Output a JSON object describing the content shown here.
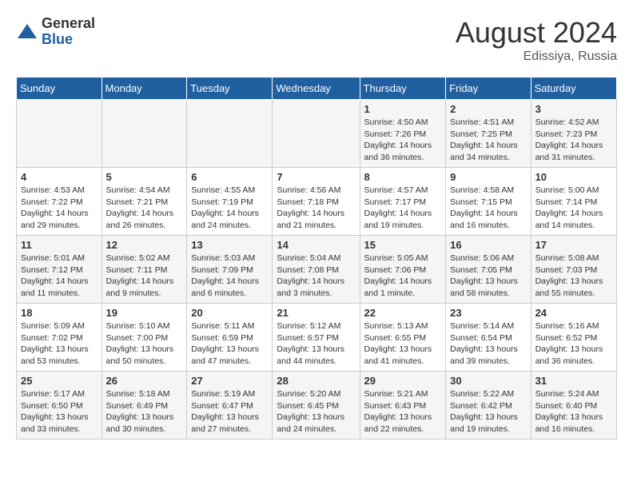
{
  "header": {
    "logo_general": "General",
    "logo_blue": "Blue",
    "month_title": "August 2024",
    "location": "Edissiya, Russia"
  },
  "weekdays": [
    "Sunday",
    "Monday",
    "Tuesday",
    "Wednesday",
    "Thursday",
    "Friday",
    "Saturday"
  ],
  "weeks": [
    [
      {
        "day": "",
        "info": ""
      },
      {
        "day": "",
        "info": ""
      },
      {
        "day": "",
        "info": ""
      },
      {
        "day": "",
        "info": ""
      },
      {
        "day": "1",
        "info": "Sunrise: 4:50 AM\nSunset: 7:26 PM\nDaylight: 14 hours\nand 36 minutes."
      },
      {
        "day": "2",
        "info": "Sunrise: 4:51 AM\nSunset: 7:25 PM\nDaylight: 14 hours\nand 34 minutes."
      },
      {
        "day": "3",
        "info": "Sunrise: 4:52 AM\nSunset: 7:23 PM\nDaylight: 14 hours\nand 31 minutes."
      }
    ],
    [
      {
        "day": "4",
        "info": "Sunrise: 4:53 AM\nSunset: 7:22 PM\nDaylight: 14 hours\nand 29 minutes."
      },
      {
        "day": "5",
        "info": "Sunrise: 4:54 AM\nSunset: 7:21 PM\nDaylight: 14 hours\nand 26 minutes."
      },
      {
        "day": "6",
        "info": "Sunrise: 4:55 AM\nSunset: 7:19 PM\nDaylight: 14 hours\nand 24 minutes."
      },
      {
        "day": "7",
        "info": "Sunrise: 4:56 AM\nSunset: 7:18 PM\nDaylight: 14 hours\nand 21 minutes."
      },
      {
        "day": "8",
        "info": "Sunrise: 4:57 AM\nSunset: 7:17 PM\nDaylight: 14 hours\nand 19 minutes."
      },
      {
        "day": "9",
        "info": "Sunrise: 4:58 AM\nSunset: 7:15 PM\nDaylight: 14 hours\nand 16 minutes."
      },
      {
        "day": "10",
        "info": "Sunrise: 5:00 AM\nSunset: 7:14 PM\nDaylight: 14 hours\nand 14 minutes."
      }
    ],
    [
      {
        "day": "11",
        "info": "Sunrise: 5:01 AM\nSunset: 7:12 PM\nDaylight: 14 hours\nand 11 minutes."
      },
      {
        "day": "12",
        "info": "Sunrise: 5:02 AM\nSunset: 7:11 PM\nDaylight: 14 hours\nand 9 minutes."
      },
      {
        "day": "13",
        "info": "Sunrise: 5:03 AM\nSunset: 7:09 PM\nDaylight: 14 hours\nand 6 minutes."
      },
      {
        "day": "14",
        "info": "Sunrise: 5:04 AM\nSunset: 7:08 PM\nDaylight: 14 hours\nand 3 minutes."
      },
      {
        "day": "15",
        "info": "Sunrise: 5:05 AM\nSunset: 7:06 PM\nDaylight: 14 hours\nand 1 minute."
      },
      {
        "day": "16",
        "info": "Sunrise: 5:06 AM\nSunset: 7:05 PM\nDaylight: 13 hours\nand 58 minutes."
      },
      {
        "day": "17",
        "info": "Sunrise: 5:08 AM\nSunset: 7:03 PM\nDaylight: 13 hours\nand 55 minutes."
      }
    ],
    [
      {
        "day": "18",
        "info": "Sunrise: 5:09 AM\nSunset: 7:02 PM\nDaylight: 13 hours\nand 53 minutes."
      },
      {
        "day": "19",
        "info": "Sunrise: 5:10 AM\nSunset: 7:00 PM\nDaylight: 13 hours\nand 50 minutes."
      },
      {
        "day": "20",
        "info": "Sunrise: 5:11 AM\nSunset: 6:59 PM\nDaylight: 13 hours\nand 47 minutes."
      },
      {
        "day": "21",
        "info": "Sunrise: 5:12 AM\nSunset: 6:57 PM\nDaylight: 13 hours\nand 44 minutes."
      },
      {
        "day": "22",
        "info": "Sunrise: 5:13 AM\nSunset: 6:55 PM\nDaylight: 13 hours\nand 41 minutes."
      },
      {
        "day": "23",
        "info": "Sunrise: 5:14 AM\nSunset: 6:54 PM\nDaylight: 13 hours\nand 39 minutes."
      },
      {
        "day": "24",
        "info": "Sunrise: 5:16 AM\nSunset: 6:52 PM\nDaylight: 13 hours\nand 36 minutes."
      }
    ],
    [
      {
        "day": "25",
        "info": "Sunrise: 5:17 AM\nSunset: 6:50 PM\nDaylight: 13 hours\nand 33 minutes."
      },
      {
        "day": "26",
        "info": "Sunrise: 5:18 AM\nSunset: 6:49 PM\nDaylight: 13 hours\nand 30 minutes."
      },
      {
        "day": "27",
        "info": "Sunrise: 5:19 AM\nSunset: 6:47 PM\nDaylight: 13 hours\nand 27 minutes."
      },
      {
        "day": "28",
        "info": "Sunrise: 5:20 AM\nSunset: 6:45 PM\nDaylight: 13 hours\nand 24 minutes."
      },
      {
        "day": "29",
        "info": "Sunrise: 5:21 AM\nSunset: 6:43 PM\nDaylight: 13 hours\nand 22 minutes."
      },
      {
        "day": "30",
        "info": "Sunrise: 5:22 AM\nSunset: 6:42 PM\nDaylight: 13 hours\nand 19 minutes."
      },
      {
        "day": "31",
        "info": "Sunrise: 5:24 AM\nSunset: 6:40 PM\nDaylight: 13 hours\nand 16 minutes."
      }
    ]
  ]
}
